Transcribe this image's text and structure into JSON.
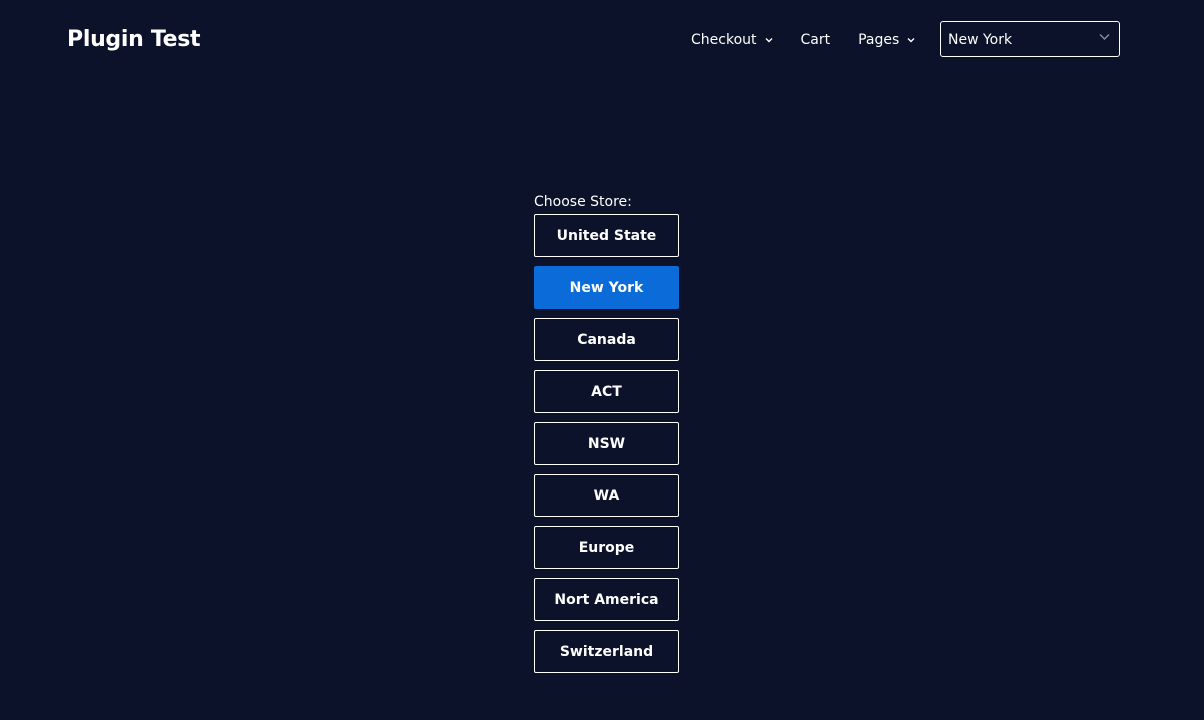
{
  "site": {
    "title": "Plugin Test"
  },
  "nav": {
    "items": [
      {
        "label": "Checkout",
        "has_dropdown": true,
        "icon": "chevron-down-icon"
      },
      {
        "label": "Cart",
        "has_dropdown": false
      },
      {
        "label": "Pages",
        "has_dropdown": true,
        "icon": "chevron-down-icon"
      }
    ]
  },
  "store_select": {
    "value": "New York",
    "icon": "chevron-down-icon"
  },
  "chooser": {
    "label": "Choose Store:",
    "stores": [
      {
        "label": "United State",
        "active": false
      },
      {
        "label": "New York",
        "active": true
      },
      {
        "label": "Canada",
        "active": false
      },
      {
        "label": "ACT",
        "active": false
      },
      {
        "label": "NSW",
        "active": false
      },
      {
        "label": "WA",
        "active": false
      },
      {
        "label": "Europe",
        "active": false
      },
      {
        "label": "Nort America",
        "active": false
      },
      {
        "label": "Switzerland",
        "active": false
      }
    ]
  },
  "colors": {
    "background": "#0b1229",
    "text": "#ffffff",
    "active_button": "#0a6bd9",
    "select_chevron": "#7d8aa8"
  }
}
